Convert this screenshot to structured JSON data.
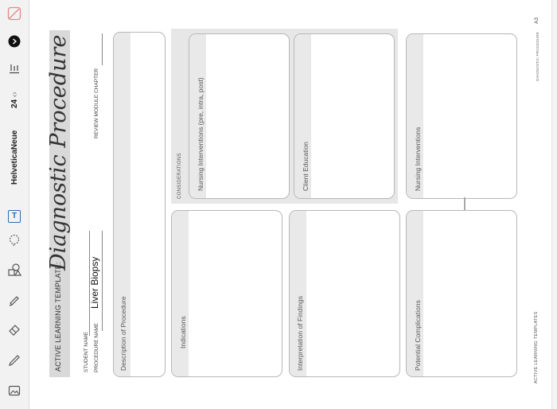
{
  "toolbar": {
    "tools": [
      {
        "name": "close-tool-icon"
      },
      {
        "name": "color-picker-icon"
      },
      {
        "name": "text-options-icon"
      },
      {
        "name": "font-size-stepper"
      },
      {
        "name": "font-name-button"
      },
      {
        "name": "text-tool-icon"
      },
      {
        "name": "lasso-tool-icon"
      },
      {
        "name": "shapes-tool-icon"
      },
      {
        "name": "highlighter-tool-icon"
      },
      {
        "name": "eraser-tool-icon"
      },
      {
        "name": "pencil-tool-icon"
      },
      {
        "name": "image-tool-icon"
      }
    ],
    "font_size": "24",
    "font_size_arrows": "‹›",
    "font_name": "HelveticaNeue",
    "text_tool_glyph": "T",
    "accent_color": "#2b6cb0"
  },
  "header": {
    "template_label": "ACTIVE LEARNING TEMPLATE:",
    "title": "Diagnostic Procedure",
    "student_name_label": "STUDENT NAME",
    "procedure_name_label": "PROCEDURE NAME",
    "procedure_name_value": "Liver Biopsy",
    "review_module_label": "REVIEW MODULE CHAPTER"
  },
  "sections": {
    "description": "Description of Procedure",
    "indications": "Indications",
    "interpretation": "Interpretation of Findings",
    "complications": "Potential Complications",
    "considerations": "CONSIDERATIONS",
    "nursing_pre_intra_post": "Nursing Interventions (pre, intra, post)",
    "client_education": "Client Education",
    "nursing_interventions": "Nursing Interventions"
  },
  "footer": {
    "left": "ACTIVE LEARNING TEMPLATES",
    "right": "DIAGNOSTIC PROCEDURE",
    "page": "A3"
  }
}
